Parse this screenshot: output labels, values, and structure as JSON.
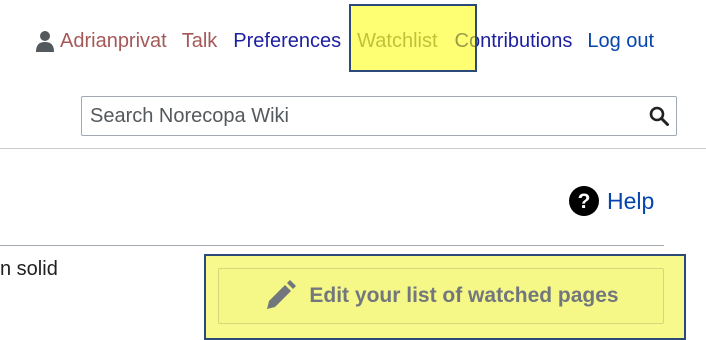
{
  "personal_nav": {
    "username": "Adrianprivat",
    "talk": "Talk",
    "preferences": "Preferences",
    "watchlist": "Watchlist",
    "contributions": "Contributions",
    "logout": "Log out",
    "user_icon": "user-icon"
  },
  "search": {
    "placeholder": "Search Norecopa Wiki",
    "value": "",
    "button_icon": "search-icon"
  },
  "help": {
    "label": "Help",
    "icon": "question-circle-icon"
  },
  "content": {
    "text_fragment": "n solid"
  },
  "watchlist_actions": {
    "edit_label": "Edit your list of watched pages",
    "edit_icon": "pencil-icon"
  },
  "colors": {
    "link_blue": "#0645ad",
    "link_red": "#a55858",
    "highlight_yellow": "#ffff00",
    "highlight_border": "#2b4a7a",
    "muted_gray": "#72777d"
  }
}
